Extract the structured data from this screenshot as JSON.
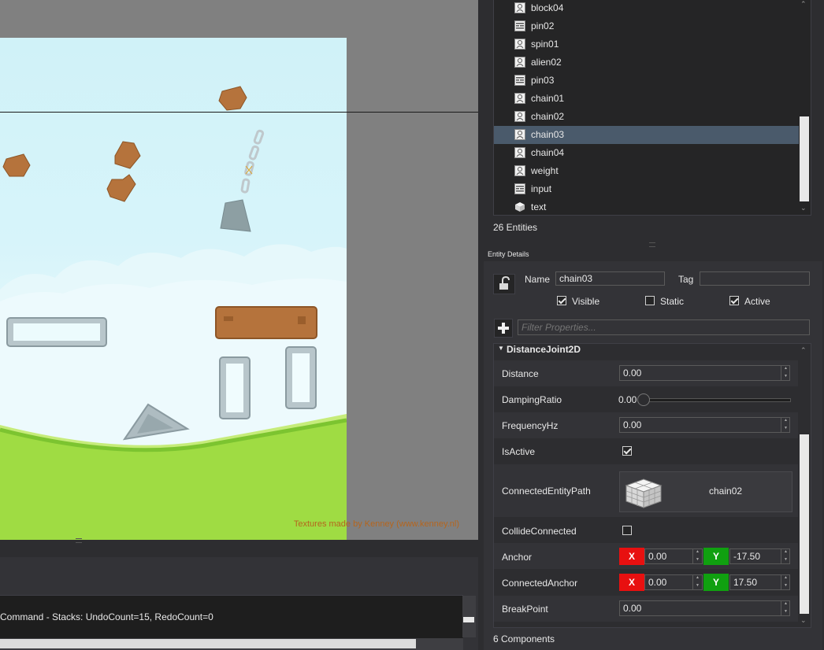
{
  "scene": {
    "watermark": "Textures made by Kenney (www.kenney.nl)"
  },
  "output": {
    "log_line": "Command - Stacks: UndoCount=15, RedoCount=0"
  },
  "entity_tree": {
    "items": [
      {
        "label": "block04",
        "icon": "sprite-icon",
        "selected": false
      },
      {
        "label": "pin02",
        "icon": "script-icon",
        "selected": false
      },
      {
        "label": "spin01",
        "icon": "sprite-icon",
        "selected": false
      },
      {
        "label": "alien02",
        "icon": "sprite-icon",
        "selected": false
      },
      {
        "label": "pin03",
        "icon": "script-icon",
        "selected": false
      },
      {
        "label": "chain01",
        "icon": "sprite-icon",
        "selected": false
      },
      {
        "label": "chain02",
        "icon": "sprite-icon",
        "selected": false
      },
      {
        "label": "chain03",
        "icon": "sprite-icon",
        "selected": true
      },
      {
        "label": "chain04",
        "icon": "sprite-icon",
        "selected": false
      },
      {
        "label": "weight",
        "icon": "sprite-icon",
        "selected": false
      },
      {
        "label": "input",
        "icon": "script-icon",
        "selected": false
      },
      {
        "label": "text",
        "icon": "cube-icon",
        "selected": false
      }
    ],
    "count_text": "26 Entities"
  },
  "details": {
    "title": "Entity Details",
    "name_label": "Name",
    "name_value": "chain03",
    "tag_label": "Tag",
    "tag_value": "",
    "visible_label": "Visible",
    "visible_checked": true,
    "static_label": "Static",
    "static_checked": false,
    "active_label": "Active",
    "active_checked": true,
    "filter_placeholder": "Filter Properties...",
    "component_header": "DistanceJoint2D",
    "props": {
      "distance_label": "Distance",
      "distance_value": "0.00",
      "damping_label": "DampingRatio",
      "damping_value": "0.00",
      "damping_fraction": 0,
      "frequency_label": "FrequencyHz",
      "frequency_value": "0.00",
      "isactive_label": "IsActive",
      "isactive_checked": true,
      "connected_entity_label": "ConnectedEntityPath",
      "connected_entity_value": "chain02",
      "collide_label": "CollideConnected",
      "collide_checked": false,
      "anchor_label": "Anchor",
      "anchor_x": "0.00",
      "anchor_y": "-17.50",
      "conn_anchor_label": "ConnectedAnchor",
      "conn_anchor_x": "0.00",
      "conn_anchor_y": "17.50",
      "axis_x": "X",
      "axis_y": "Y",
      "breakpoint_label": "BreakPoint",
      "breakpoint_value": "0.00"
    },
    "components_count": "6 Components"
  },
  "colors": {
    "selection": "#4a5a6b",
    "axis_x": "#e81010",
    "axis_y": "#10a010",
    "sky": "#d0f2f8",
    "grass": "#9fdc43"
  }
}
